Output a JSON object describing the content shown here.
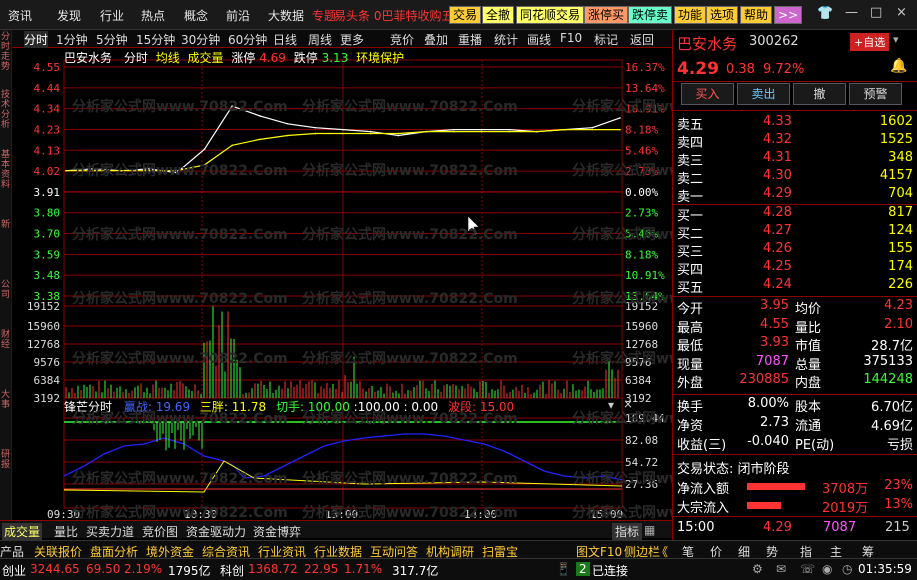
{
  "top_menu": {
    "items": [
      "资讯",
      "发现",
      "行业",
      "热点",
      "概念",
      "前沿",
      "大数据",
      "专题"
    ],
    "ticker": "易头条 0巴菲特收购五",
    "buttons": [
      {
        "label": "交易",
        "bg": "#ffcc33",
        "fg": "#000"
      },
      {
        "label": "全撤",
        "bg": "#ffff66",
        "fg": "#000"
      },
      {
        "label": "同花顺交易",
        "bg": "#ffff66",
        "fg": "#000"
      },
      {
        "label": "涨停买",
        "bg": "#ff9966",
        "fg": "#000"
      },
      {
        "label": "跌停卖",
        "bg": "#66ffcc",
        "fg": "#000"
      },
      {
        "label": "功能",
        "bg": "#ffcc33",
        "fg": "#000"
      },
      {
        "label": "选项",
        "bg": "#ffcc33",
        "fg": "#000"
      },
      {
        "label": "帮助",
        "bg": "#ffcc33",
        "fg": "#000"
      },
      {
        "label": ">>",
        "bg": "#cc66cc",
        "fg": "#fff"
      }
    ],
    "win": [
      "—",
      "□",
      "×"
    ]
  },
  "left_strip": [
    "分时走势",
    "技术分析",
    "基本资料",
    "新",
    "公司",
    "财经",
    "大事",
    "研报"
  ],
  "period_tabs": [
    "分时",
    "1分钟",
    "5分钟",
    "15分钟",
    "30分钟",
    "60分钟",
    "日线",
    "周线",
    "更多",
    "竞价",
    "叠加",
    "重播",
    "统计",
    "画线",
    "F10",
    "标记",
    "返回"
  ],
  "chart_header": {
    "name": "巴安水务",
    "view": "分时",
    "avg": "均线",
    "vol": "成交量",
    "limit_up_label": "涨停",
    "limit_up": "4.69",
    "limit_down_label": "跌停",
    "limit_down": "3.13",
    "env": "环境保护"
  },
  "price_axis": {
    "left": [
      "4.55",
      "4.44",
      "4.34",
      "4.23",
      "4.13",
      "4.02",
      "3.91",
      "3.80",
      "3.70",
      "3.59",
      "3.48",
      "3.38"
    ],
    "right": [
      "16.37%",
      "13.64%",
      "10.91%",
      "8.18%",
      "5.46%",
      "2.73%",
      "0.00%",
      "2.73%",
      "5.46%",
      "8.18%",
      "10.91%",
      "13.64%"
    ]
  },
  "volume_axis": [
    "19152",
    "15960",
    "12768",
    "9576",
    "6384",
    "3192"
  ],
  "indicator": {
    "name": "锋芒分时",
    "a_label": "赢战:",
    "a_val": "19.69",
    "b_label": "三胖:",
    "b_val": "11.78",
    "c_label": "切手:",
    "c_val": "100.00",
    "d_val": ":100.00",
    "e_val": ": 0.00",
    "f_label": "波段:",
    "f_val": "15.00",
    "axis": [
      "109.44",
      "82.08",
      "54.72",
      "27.36"
    ]
  },
  "time_axis": [
    "09:30",
    "10:30",
    "13:00",
    "14:00",
    "15:00"
  ],
  "watermark": "分析家公式网www.70822.Com",
  "chart_tabs": [
    "成交量",
    "量比",
    "买卖力道",
    "竞价图",
    "资金驱动力",
    "资金博弈"
  ],
  "chart_tabs_right": "指标",
  "status1": {
    "items": [
      "产品",
      "关联报价",
      "盘面分析",
      "境外资金",
      "综合资讯",
      "行业资讯",
      "行业数据",
      "互动问答",
      "机构调研",
      "扫雷宝"
    ],
    "right": [
      "图文F10",
      "侧边栏",
      "《"
    ],
    "icons": [
      "笔",
      "价",
      "细",
      "势",
      "指",
      "主",
      "筹"
    ]
  },
  "status2": {
    "idx1_name": "创业",
    "idx1_val": "3244.65",
    "idx1_chg": "69.50",
    "idx1_pct": "2.19%",
    "idx1_amt": "1795亿",
    "idx2_name": "科创",
    "idx2_val": "1368.72",
    "idx2_chg": "22.95",
    "idx2_pct": "1.71%",
    "idx2_amt": "317.7亿",
    "conn_count": "2",
    "conn": "已连接",
    "time": "01:35:59"
  },
  "quote": {
    "name": "巴安水务",
    "code": "300262",
    "add": "+自选",
    "price": "4.29",
    "chg": "0.38",
    "pct": "9.72%",
    "buttons": [
      "买入",
      "卖出",
      "撤",
      "预警"
    ],
    "asks": [
      {
        "l": "卖五",
        "p": "4.33",
        "v": "1602"
      },
      {
        "l": "卖四",
        "p": "4.32",
        "v": "1525"
      },
      {
        "l": "卖三",
        "p": "4.31",
        "v": "348"
      },
      {
        "l": "卖二",
        "p": "4.30",
        "v": "4157"
      },
      {
        "l": "卖一",
        "p": "4.29",
        "v": "704"
      }
    ],
    "bids": [
      {
        "l": "买一",
        "p": "4.28",
        "v": "817"
      },
      {
        "l": "买二",
        "p": "4.27",
        "v": "124"
      },
      {
        "l": "买三",
        "p": "4.26",
        "v": "155"
      },
      {
        "l": "买四",
        "p": "4.25",
        "v": "174"
      },
      {
        "l": "买五",
        "p": "4.24",
        "v": "226"
      }
    ],
    "stats": [
      {
        "l1": "今开",
        "v1": "3.95",
        "l2": "均价",
        "v2": "4.23"
      },
      {
        "l1": "最高",
        "v1": "4.55",
        "l2": "量比",
        "v2": "2.10"
      },
      {
        "l1": "最低",
        "v1": "3.93",
        "l2": "市值",
        "v2": "28.7亿"
      },
      {
        "l1": "现量",
        "v1": "7087",
        "l2": "总量",
        "v2": "375133"
      },
      {
        "l1": "外盘",
        "v1": "230885",
        "l2": "内盘",
        "v2": "144248"
      }
    ],
    "stats2": [
      {
        "l1": "换手",
        "v1": "8.00%",
        "l2": "股本",
        "v2": "6.70亿"
      },
      {
        "l1": "净资",
        "v1": "2.73",
        "l2": "流通",
        "v2": "4.69亿"
      },
      {
        "l1": "收益(三)",
        "v1": "-0.040",
        "l2": "PE(动)",
        "v2": "亏损"
      }
    ],
    "trade_status": "交易状态: 闭市阶段",
    "flows": [
      {
        "l": "净流入额",
        "v": "3708万",
        "p": "23%",
        "fill": 0.72
      },
      {
        "l": "大宗流入",
        "v": "2019万",
        "p": "13%",
        "fill": 0.42
      }
    ],
    "last_tick": {
      "time": "15:00",
      "price": "4.29",
      "vol": "7087",
      "num": "215"
    }
  },
  "colors": {
    "up": "#ff3333",
    "down": "#33ff33",
    "grid": "#8b0000",
    "avg": "#ffff00",
    "price": "#ffffff",
    "blue": "#3333ff"
  },
  "chart_data": {
    "type": "line",
    "x": [
      "09:30",
      "09:45",
      "10:00",
      "10:15",
      "10:20",
      "10:25",
      "10:30",
      "10:40",
      "10:50",
      "11:00",
      "11:15",
      "11:30",
      "13:00",
      "13:15",
      "13:30",
      "13:45",
      "14:00",
      "14:15",
      "14:30",
      "14:45",
      "15:00"
    ],
    "series": [
      {
        "values": [
          4.02,
          4.03,
          4.02,
          4.03,
          4.01,
          4.13,
          4.35,
          4.3,
          4.26,
          4.24,
          4.23,
          4.22,
          4.2,
          4.22,
          4.23,
          4.23,
          4.23,
          4.22,
          4.23,
          4.24,
          4.29
        ]
      },
      {
        "values": [
          4.02,
          4.02,
          4.02,
          4.02,
          4.02,
          4.05,
          4.15,
          4.18,
          4.2,
          4.21,
          4.21,
          4.21,
          4.21,
          4.22,
          4.22,
          4.22,
          4.22,
          4.22,
          4.23,
          4.23,
          4.23
        ]
      }
    ],
    "ylim": [
      3.38,
      4.55
    ],
    "grid": true
  }
}
